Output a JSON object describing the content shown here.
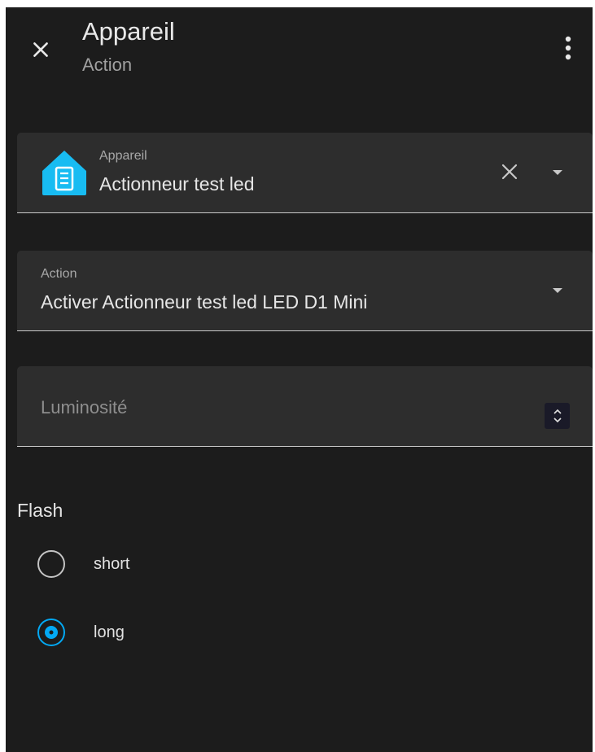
{
  "header": {
    "title": "Appareil",
    "subtitle": "Action",
    "close_icon": "close-icon",
    "menu_icon": "dots-vertical-icon"
  },
  "device_field": {
    "label": "Appareil",
    "value": "Actionneur test led",
    "icon": "home-assistant-logo-icon",
    "icon_color": "#18bcf2"
  },
  "action_field": {
    "label": "Action",
    "value": "Activer Actionneur test led LED D1 Mini"
  },
  "luminosity_field": {
    "placeholder": "Luminosité"
  },
  "flash": {
    "label": "Flash",
    "options": [
      {
        "label": "short",
        "selected": false
      },
      {
        "label": "long",
        "selected": true
      }
    ],
    "accent_color": "#03a9f4"
  }
}
